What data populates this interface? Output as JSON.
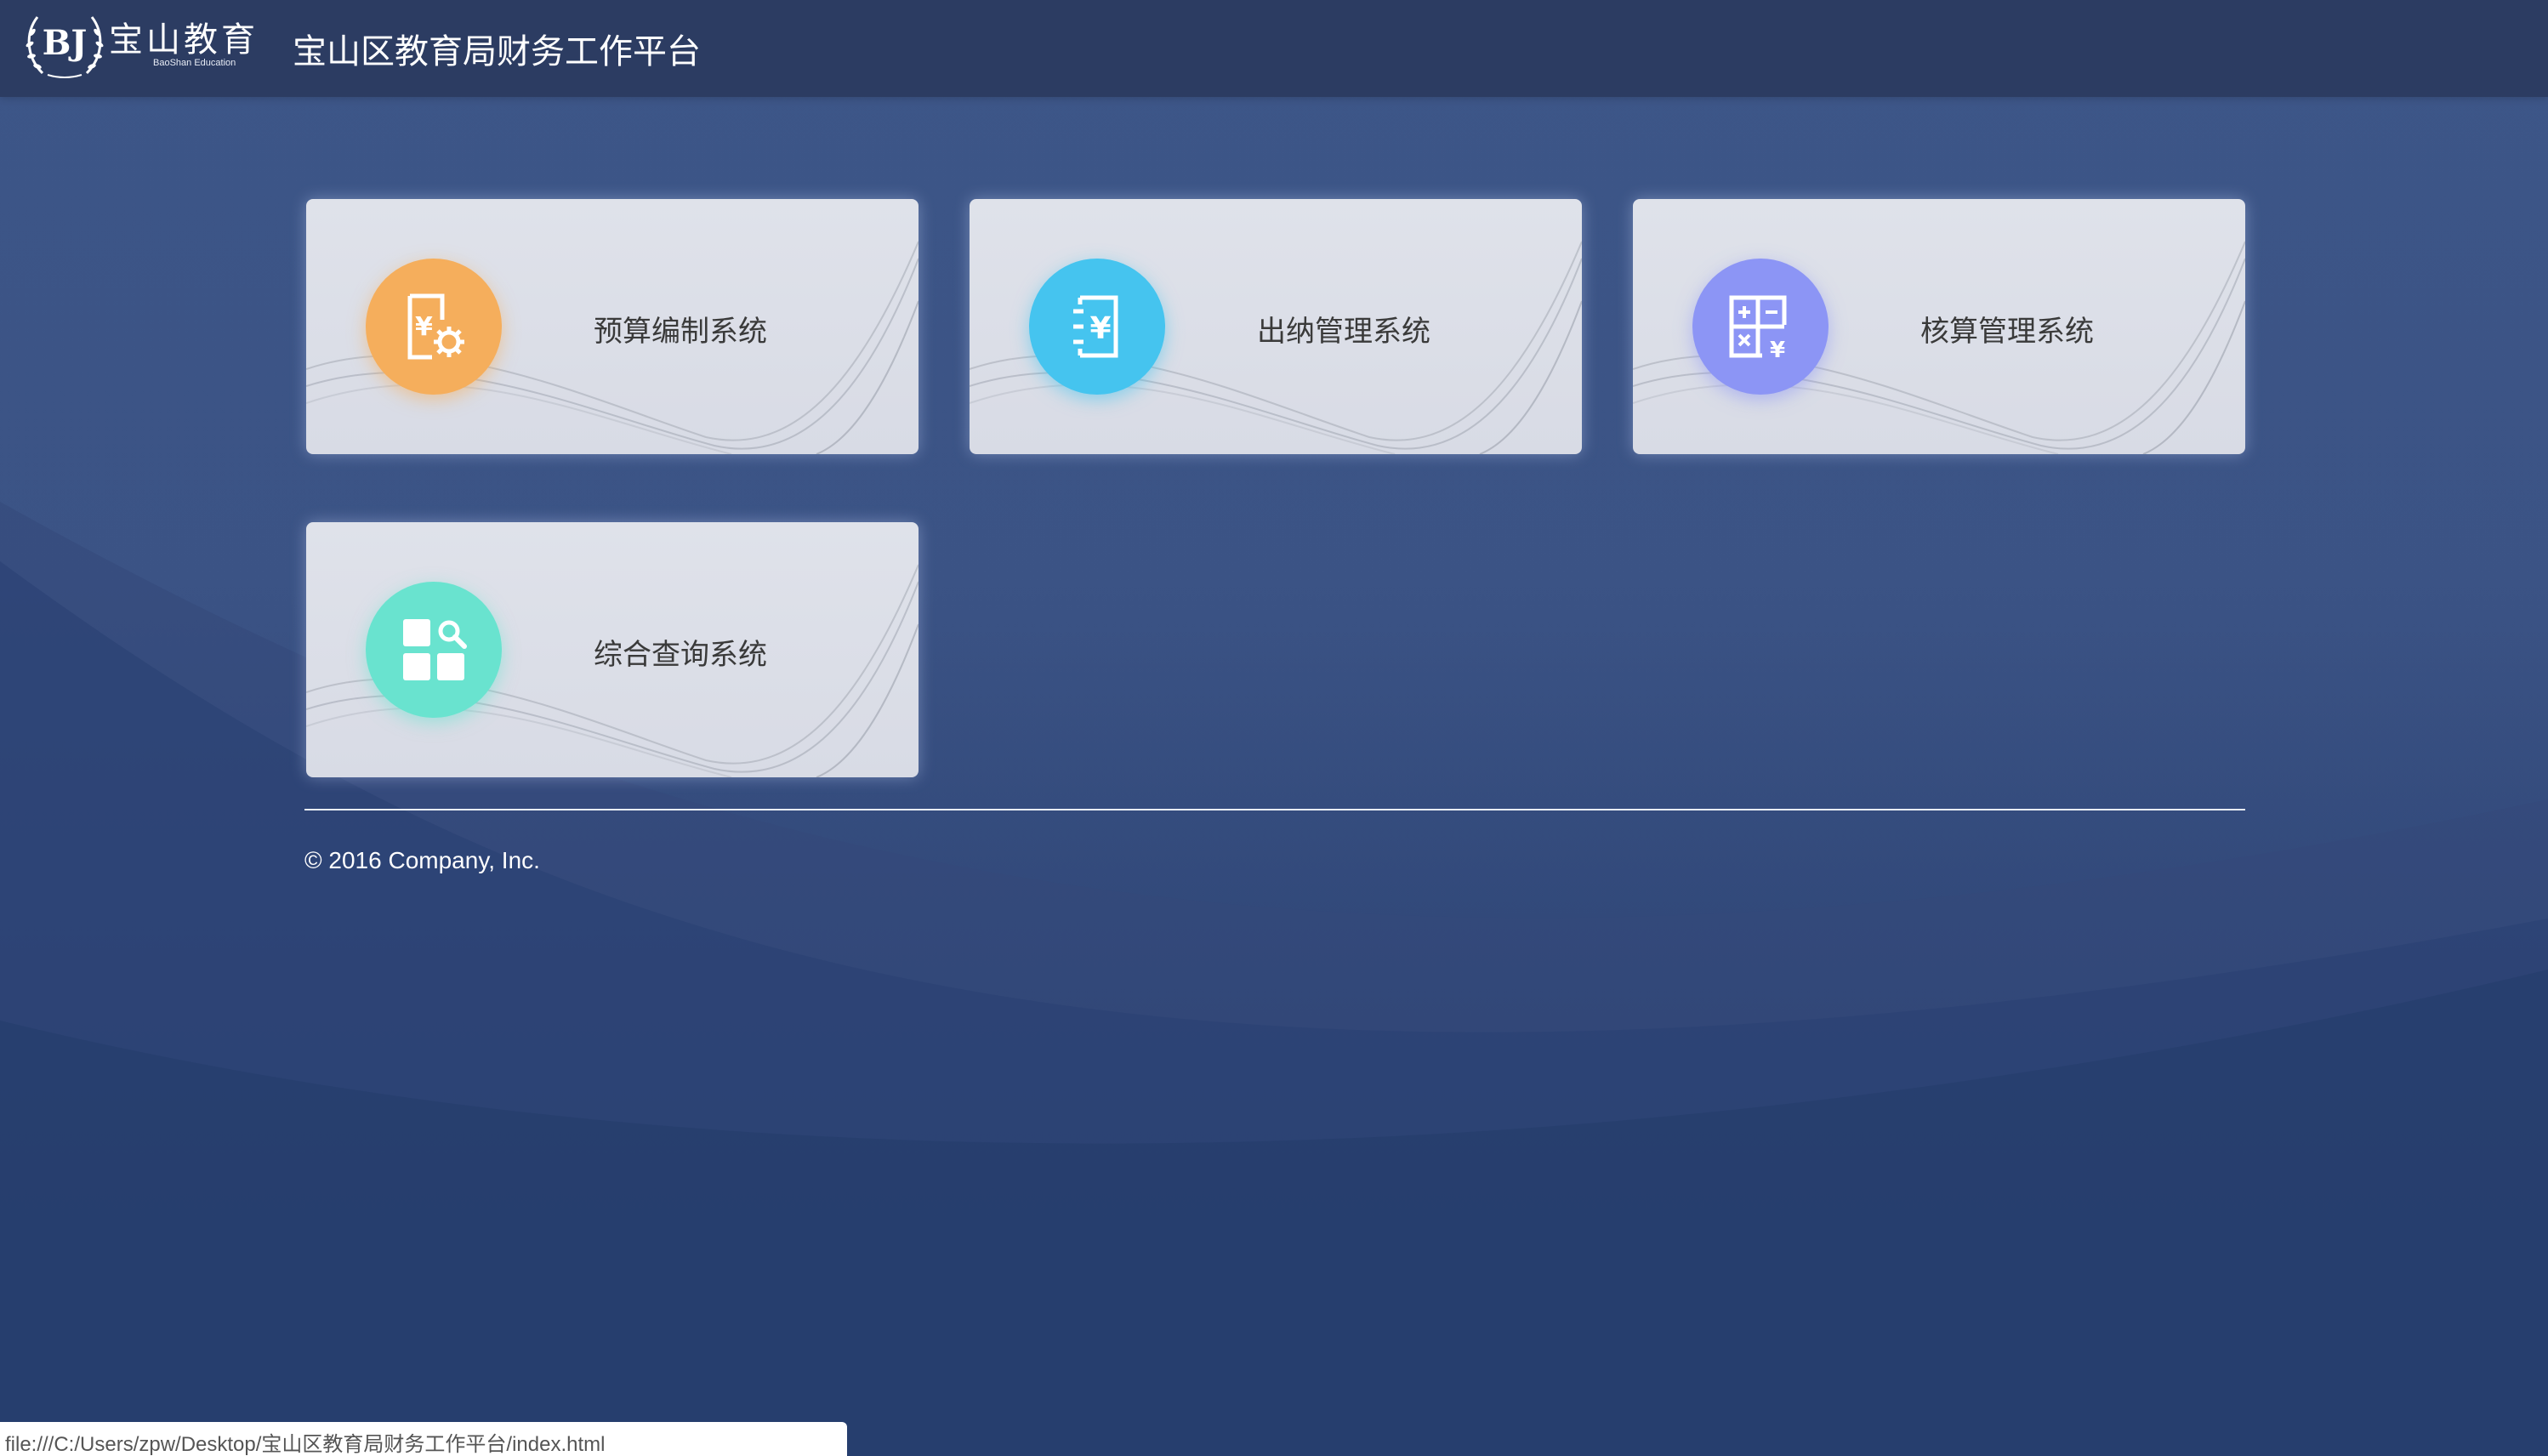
{
  "header": {
    "logo": {
      "monogram": "BJ",
      "name_cn": "宝山教育",
      "name_en": "BaoShan Education"
    },
    "title": "宝山区教育局财务工作平台"
  },
  "cards": [
    {
      "label": "预算编制系统",
      "icon": "budget-yuan-gear-icon",
      "color": "#f5ae5c"
    },
    {
      "label": "出纳管理系统",
      "icon": "cashier-yuan-icon",
      "color": "#45c4ef"
    },
    {
      "label": "核算管理系统",
      "icon": "calculator-icon",
      "color": "#8c95f5"
    },
    {
      "label": "综合查询系统",
      "icon": "query-grid-search-icon",
      "color": "#69e3cf"
    }
  ],
  "footer": {
    "copyright": "© 2016 Company, Inc."
  },
  "statusbar": {
    "url": "file:///C:/Users/zpw/Desktop/宝山区教育局财务工作平台/index.html"
  },
  "colors": {
    "header_bg": "#2c3c62",
    "page_bg": "#3b5385"
  }
}
